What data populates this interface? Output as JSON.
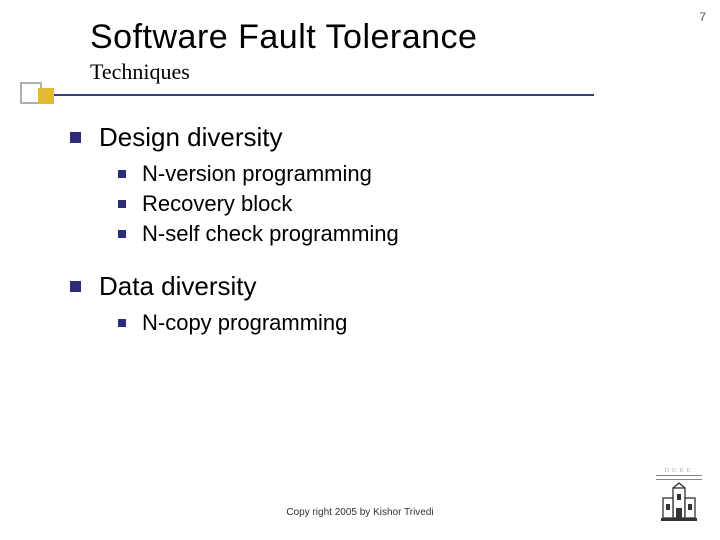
{
  "page_number": "7",
  "title": "Software Fault Tolerance",
  "subtitle": "Techniques",
  "items": [
    {
      "label": "Design diversity",
      "children": [
        {
          "label": "N-version programming"
        },
        {
          "label": "Recovery block"
        },
        {
          "label": "N-self check programming"
        }
      ]
    },
    {
      "label": "Data diversity",
      "children": [
        {
          "label": "N-copy programming"
        }
      ]
    }
  ],
  "footer": "Copy right 2005 by Kishor Trivedi",
  "logo_text": "DUKE"
}
